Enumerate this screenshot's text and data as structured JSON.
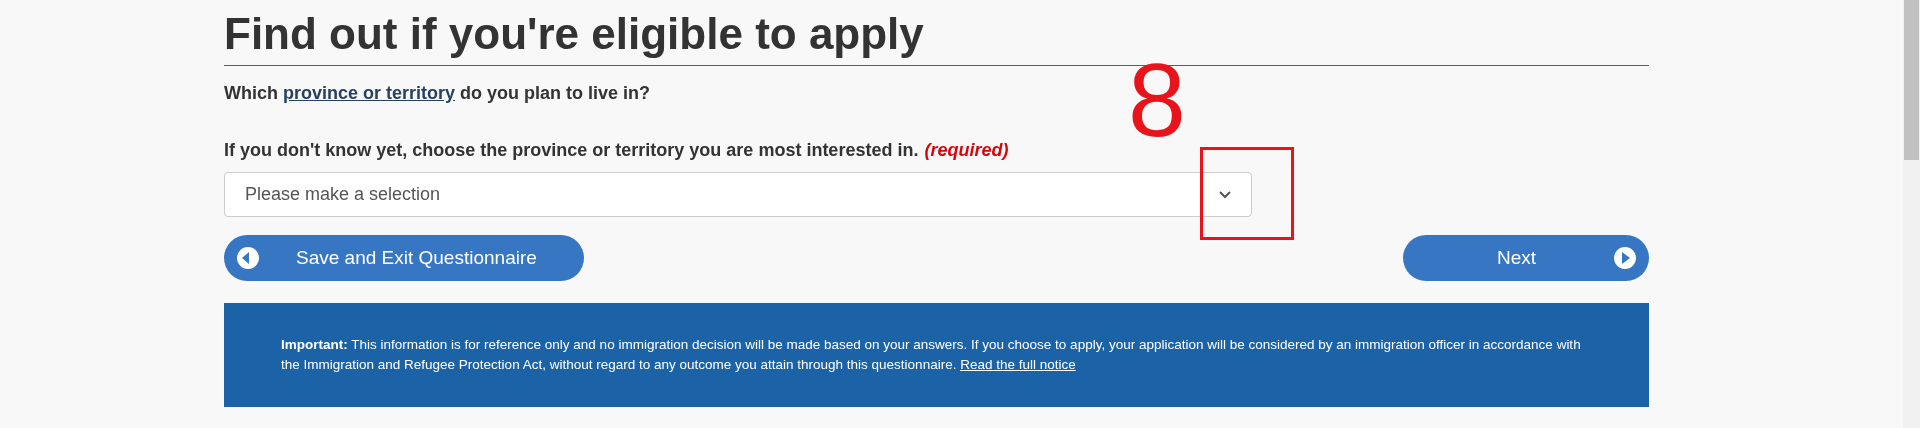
{
  "heading": "Find out if you're eligible to apply",
  "question": {
    "before": "Which",
    "link": "province or territory",
    "after": "do you plan to live in?"
  },
  "field": {
    "label": "If you don't know yet, choose the province or territory you are most interested in.",
    "required": "(required)",
    "placeholder": "Please make a selection"
  },
  "buttons": [
    {
      "kind": "back",
      "label": "Save and Exit Questionnaire"
    },
    {
      "kind": "next",
      "label": "Next"
    }
  ],
  "notice": {
    "text": "**Important:** This information is for reference only and no immigration decision will be made based on your answers. If you choose to apply, your application will be considered by an immigration officer in accordance with the Immigration and Refugee Protection Act, without regard to any outcome you attain through this questionnaire.",
    "link": "Read the full notice"
  },
  "annotation": {
    "label": "8"
  }
}
